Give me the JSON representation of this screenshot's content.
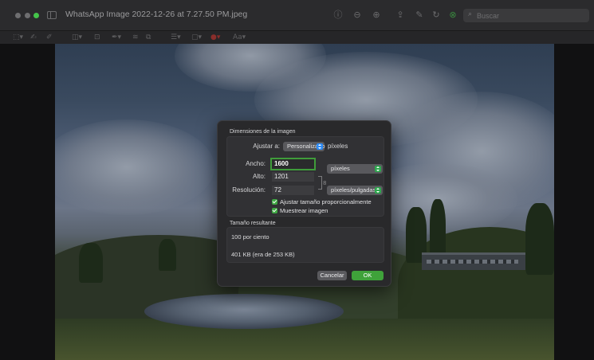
{
  "window": {
    "title": "WhatsApp Image 2022-12-26 at 7.27.50 PM.jpeg"
  },
  "toolbar": {
    "search_placeholder": "Buscar",
    "icons": [
      "info-icon",
      "zoom-out-icon",
      "zoom-in-icon",
      "share-icon",
      "highlight-icon",
      "rotate-icon",
      "markup-icon"
    ]
  },
  "markup_toolbar": {
    "tools": [
      "selection-tool",
      "sketch-tool",
      "draw-tool",
      "shapes-tool",
      "text-tool",
      "sign-tool",
      "adjust-color-tool",
      "adjust-size-tool",
      "shape-style-tool",
      "border-color-tool",
      "fill-color-tool",
      "text-style-tool"
    ],
    "text_style_label": "Aa"
  },
  "dialog": {
    "section_dimensions": "Dimensiones de la imagen",
    "fit_label": "Ajustar a:",
    "fit_value": "Personalizado",
    "fit_unit": "píxeles",
    "width_label": "Ancho:",
    "width_value": "1600",
    "height_label": "Alto:",
    "height_value": "1201",
    "size_unit": "píxeles",
    "resolution_label": "Resolución:",
    "resolution_value": "72",
    "resolution_unit": "píxeles/pulgadas",
    "scale_proportionally_label": "Ajustar tamaño proporcionalmente",
    "scale_proportionally_checked": true,
    "resample_label": "Muestrear imagen",
    "resample_checked": true,
    "section_result": "Tamaño resultante",
    "result_percent": "100 por ciento",
    "result_size": "401 KB (era de 253 KB)",
    "cancel_label": "Cancelar",
    "ok_label": "OK"
  },
  "colors": {
    "accent_green": "#3fa23a",
    "popup_blue": "#2f8cf5",
    "dialog_bg": "#29292b"
  }
}
